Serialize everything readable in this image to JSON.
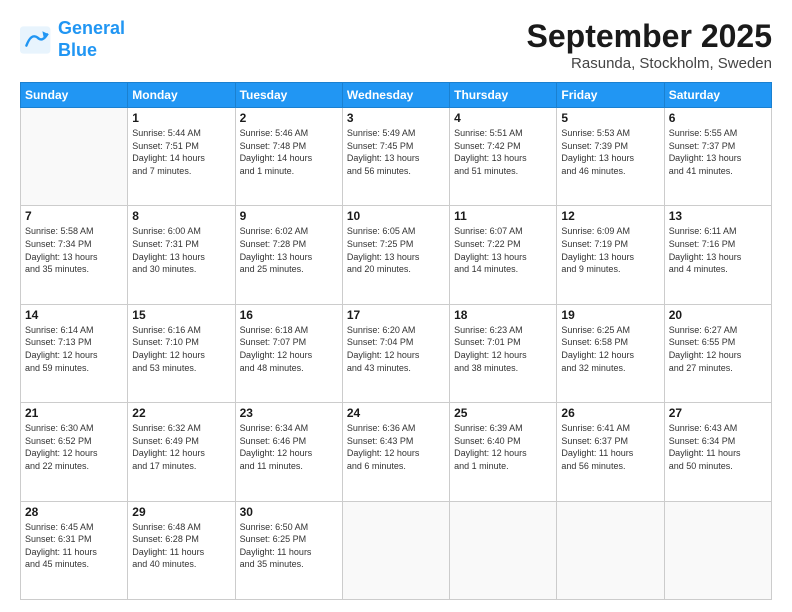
{
  "logo": {
    "line1": "General",
    "line2": "Blue"
  },
  "title": "September 2025",
  "subtitle": "Rasunda, Stockholm, Sweden",
  "days_of_week": [
    "Sunday",
    "Monday",
    "Tuesday",
    "Wednesday",
    "Thursday",
    "Friday",
    "Saturday"
  ],
  "weeks": [
    [
      {
        "day": "",
        "info": ""
      },
      {
        "day": "1",
        "info": "Sunrise: 5:44 AM\nSunset: 7:51 PM\nDaylight: 14 hours\nand 7 minutes."
      },
      {
        "day": "2",
        "info": "Sunrise: 5:46 AM\nSunset: 7:48 PM\nDaylight: 14 hours\nand 1 minute."
      },
      {
        "day": "3",
        "info": "Sunrise: 5:49 AM\nSunset: 7:45 PM\nDaylight: 13 hours\nand 56 minutes."
      },
      {
        "day": "4",
        "info": "Sunrise: 5:51 AM\nSunset: 7:42 PM\nDaylight: 13 hours\nand 51 minutes."
      },
      {
        "day": "5",
        "info": "Sunrise: 5:53 AM\nSunset: 7:39 PM\nDaylight: 13 hours\nand 46 minutes."
      },
      {
        "day": "6",
        "info": "Sunrise: 5:55 AM\nSunset: 7:37 PM\nDaylight: 13 hours\nand 41 minutes."
      }
    ],
    [
      {
        "day": "7",
        "info": "Sunrise: 5:58 AM\nSunset: 7:34 PM\nDaylight: 13 hours\nand 35 minutes."
      },
      {
        "day": "8",
        "info": "Sunrise: 6:00 AM\nSunset: 7:31 PM\nDaylight: 13 hours\nand 30 minutes."
      },
      {
        "day": "9",
        "info": "Sunrise: 6:02 AM\nSunset: 7:28 PM\nDaylight: 13 hours\nand 25 minutes."
      },
      {
        "day": "10",
        "info": "Sunrise: 6:05 AM\nSunset: 7:25 PM\nDaylight: 13 hours\nand 20 minutes."
      },
      {
        "day": "11",
        "info": "Sunrise: 6:07 AM\nSunset: 7:22 PM\nDaylight: 13 hours\nand 14 minutes."
      },
      {
        "day": "12",
        "info": "Sunrise: 6:09 AM\nSunset: 7:19 PM\nDaylight: 13 hours\nand 9 minutes."
      },
      {
        "day": "13",
        "info": "Sunrise: 6:11 AM\nSunset: 7:16 PM\nDaylight: 13 hours\nand 4 minutes."
      }
    ],
    [
      {
        "day": "14",
        "info": "Sunrise: 6:14 AM\nSunset: 7:13 PM\nDaylight: 12 hours\nand 59 minutes."
      },
      {
        "day": "15",
        "info": "Sunrise: 6:16 AM\nSunset: 7:10 PM\nDaylight: 12 hours\nand 53 minutes."
      },
      {
        "day": "16",
        "info": "Sunrise: 6:18 AM\nSunset: 7:07 PM\nDaylight: 12 hours\nand 48 minutes."
      },
      {
        "day": "17",
        "info": "Sunrise: 6:20 AM\nSunset: 7:04 PM\nDaylight: 12 hours\nand 43 minutes."
      },
      {
        "day": "18",
        "info": "Sunrise: 6:23 AM\nSunset: 7:01 PM\nDaylight: 12 hours\nand 38 minutes."
      },
      {
        "day": "19",
        "info": "Sunrise: 6:25 AM\nSunset: 6:58 PM\nDaylight: 12 hours\nand 32 minutes."
      },
      {
        "day": "20",
        "info": "Sunrise: 6:27 AM\nSunset: 6:55 PM\nDaylight: 12 hours\nand 27 minutes."
      }
    ],
    [
      {
        "day": "21",
        "info": "Sunrise: 6:30 AM\nSunset: 6:52 PM\nDaylight: 12 hours\nand 22 minutes."
      },
      {
        "day": "22",
        "info": "Sunrise: 6:32 AM\nSunset: 6:49 PM\nDaylight: 12 hours\nand 17 minutes."
      },
      {
        "day": "23",
        "info": "Sunrise: 6:34 AM\nSunset: 6:46 PM\nDaylight: 12 hours\nand 11 minutes."
      },
      {
        "day": "24",
        "info": "Sunrise: 6:36 AM\nSunset: 6:43 PM\nDaylight: 12 hours\nand 6 minutes."
      },
      {
        "day": "25",
        "info": "Sunrise: 6:39 AM\nSunset: 6:40 PM\nDaylight: 12 hours\nand 1 minute."
      },
      {
        "day": "26",
        "info": "Sunrise: 6:41 AM\nSunset: 6:37 PM\nDaylight: 11 hours\nand 56 minutes."
      },
      {
        "day": "27",
        "info": "Sunrise: 6:43 AM\nSunset: 6:34 PM\nDaylight: 11 hours\nand 50 minutes."
      }
    ],
    [
      {
        "day": "28",
        "info": "Sunrise: 6:45 AM\nSunset: 6:31 PM\nDaylight: 11 hours\nand 45 minutes."
      },
      {
        "day": "29",
        "info": "Sunrise: 6:48 AM\nSunset: 6:28 PM\nDaylight: 11 hours\nand 40 minutes."
      },
      {
        "day": "30",
        "info": "Sunrise: 6:50 AM\nSunset: 6:25 PM\nDaylight: 11 hours\nand 35 minutes."
      },
      {
        "day": "",
        "info": ""
      },
      {
        "day": "",
        "info": ""
      },
      {
        "day": "",
        "info": ""
      },
      {
        "day": "",
        "info": ""
      }
    ]
  ]
}
